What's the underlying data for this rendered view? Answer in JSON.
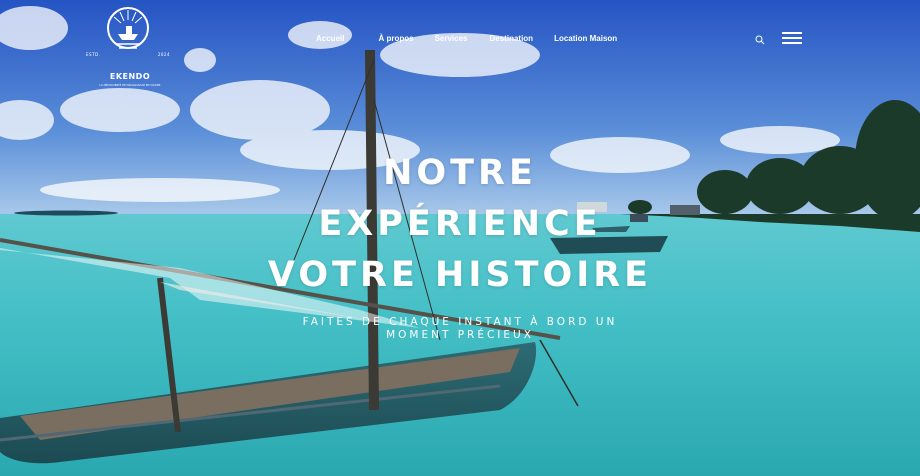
{
  "logo": {
    "estd": "ESTD.",
    "year": "2024",
    "name": "EKENDO",
    "tagline": "LA DÉCOUVERTE DE MADAGASCAR EN VOILIER"
  },
  "nav": {
    "items": [
      "Accueil",
      "À propos",
      "Services",
      "Destination",
      "Location Maison"
    ]
  },
  "header": {
    "search_icon": "search-icon",
    "menu_icon": "hamburger-menu-icon"
  },
  "hero": {
    "line1": "NOTRE",
    "line2": "EXPÉRIENCE",
    "line3": "VOTRE HISTOIRE",
    "sub1": "FAITES DE CHAQUE INSTANT À BORD UN",
    "sub2": "MOMENT PRÉCIEUX"
  },
  "colors": {
    "sky": "#2f63c8",
    "sea": "#3fc0c4",
    "text": "#ffffff"
  }
}
